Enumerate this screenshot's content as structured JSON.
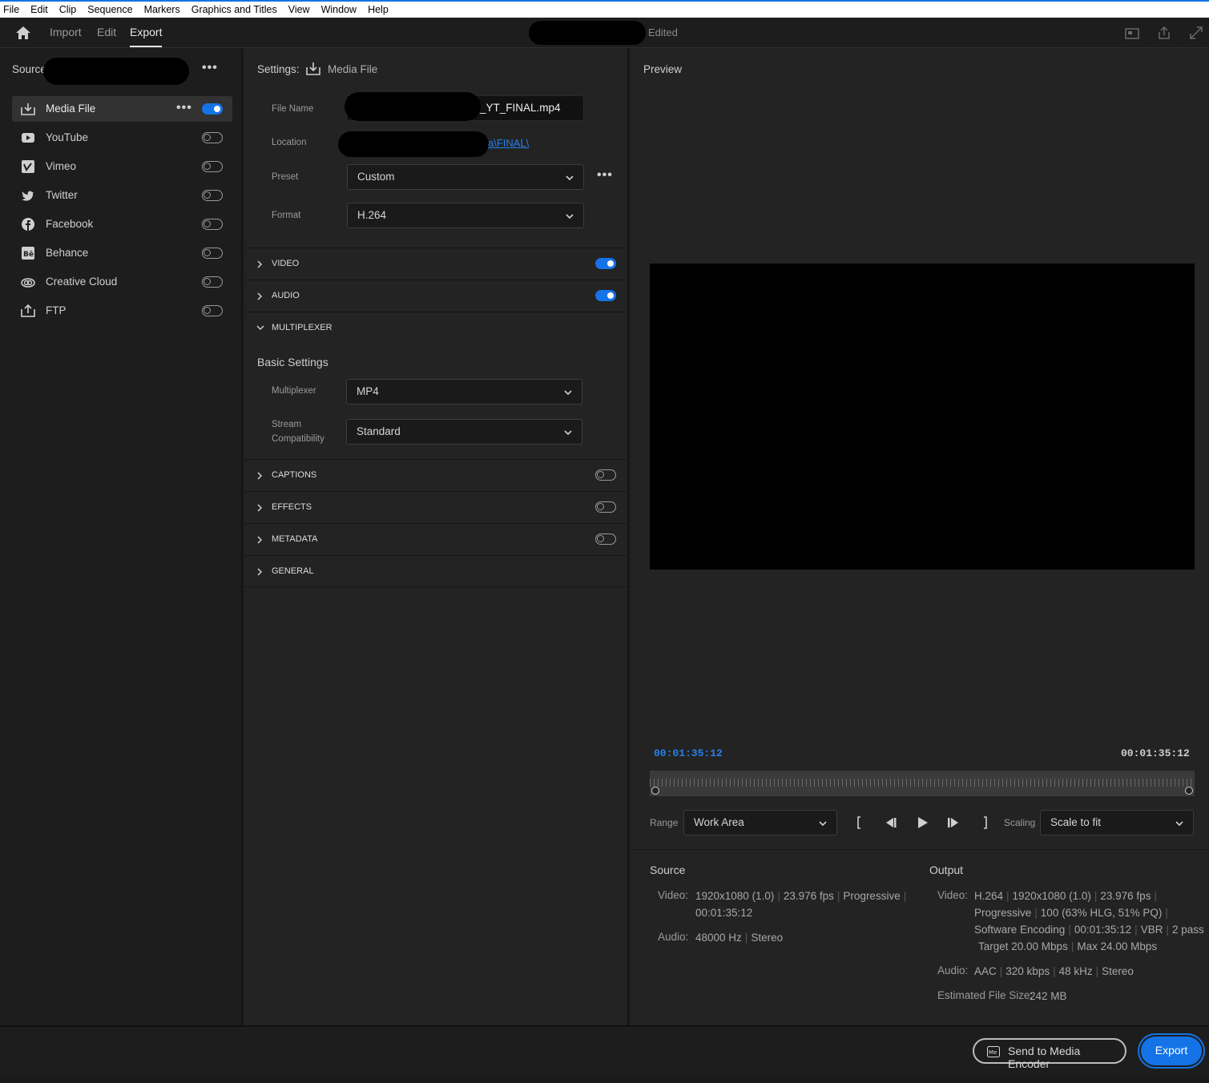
{
  "menu": [
    "File",
    "Edit",
    "Clip",
    "Sequence",
    "Markers",
    "Graphics and Titles",
    "View",
    "Window",
    "Help"
  ],
  "header": {
    "workspaces": [
      "Import",
      "Edit",
      "Export"
    ],
    "active_workspace": "Export",
    "project_status": "Edited"
  },
  "source_panel": {
    "title": "Source",
    "destinations": [
      {
        "label": "Media File",
        "icon": "media-file-icon",
        "enabled": true,
        "selected": true
      },
      {
        "label": "YouTube",
        "icon": "youtube-icon",
        "enabled": false
      },
      {
        "label": "Vimeo",
        "icon": "vimeo-icon",
        "enabled": false
      },
      {
        "label": "Twitter",
        "icon": "twitter-icon",
        "enabled": false
      },
      {
        "label": "Facebook",
        "icon": "facebook-icon",
        "enabled": false
      },
      {
        "label": "Behance",
        "icon": "behance-icon",
        "enabled": false
      },
      {
        "label": "Creative Cloud",
        "icon": "creative-cloud-icon",
        "enabled": false
      },
      {
        "label": "FTP",
        "icon": "ftp-icon",
        "enabled": false
      }
    ]
  },
  "settings": {
    "title": "Settings:",
    "subtitle": "Media File",
    "file_name_label": "File Name",
    "file_name_value": "_YT_FINAL.mp4",
    "location_label": "Location",
    "location_value": "a\\FINAL\\",
    "preset_label": "Preset",
    "preset_value": "Custom",
    "format_label": "Format",
    "format_value": "H.264",
    "sections": [
      {
        "title": "VIDEO",
        "expanded": false,
        "toggle": "on"
      },
      {
        "title": "AUDIO",
        "expanded": false,
        "toggle": "on"
      },
      {
        "title": "MULTIPLEXER",
        "expanded": true,
        "toggle": "none"
      },
      {
        "title": "CAPTIONS",
        "expanded": false,
        "toggle": "off"
      },
      {
        "title": "EFFECTS",
        "expanded": false,
        "toggle": "off"
      },
      {
        "title": "METADATA",
        "expanded": false,
        "toggle": "off"
      },
      {
        "title": "GENERAL",
        "expanded": false,
        "toggle": "none"
      }
    ],
    "basic_settings": "Basic Settings",
    "multiplexer_label": "Multiplexer",
    "multiplexer_value": "MP4",
    "stream_label_1": "Stream",
    "stream_label_2": "Compatibility",
    "stream_value": "Standard"
  },
  "preview": {
    "title": "Preview",
    "timecode_current": "00:01:35:12",
    "timecode_end": "00:01:35:12",
    "range_label": "Range",
    "range_value": "Work Area",
    "scaling_label": "Scaling",
    "scaling_value": "Scale to fit"
  },
  "summary": {
    "source_title": "Source",
    "output_title": "Output",
    "video_key": "Video:",
    "audio_key": "Audio:",
    "source_video": [
      "1920x1080 (1.0)",
      "23.976 fps",
      "Progressive"
    ],
    "source_video_2": "00:01:35:12",
    "source_audio": [
      "48000 Hz",
      "Stereo"
    ],
    "output_video_1": [
      "H.264",
      "1920x1080 (1.0)",
      "23.976 fps"
    ],
    "output_video_2": [
      "Progressive",
      "100 (63% HLG, 51% PQ)"
    ],
    "output_video_3": [
      "Software Encoding",
      "00:01:35:12",
      "VBR",
      "2 pass"
    ],
    "output_video_4": [
      "Target 20.00 Mbps",
      "Max 24.00 Mbps"
    ],
    "output_audio": [
      "AAC",
      "320 kbps",
      "48 kHz",
      "Stereo"
    ],
    "file_size_label": "Estimated File Size:",
    "file_size_value": "242 MB"
  },
  "footer": {
    "send_label": "Send to Media Encoder",
    "export_label": "Export"
  },
  "colors": {
    "accent": "#1473e6",
    "timecode": "#2680eb"
  }
}
